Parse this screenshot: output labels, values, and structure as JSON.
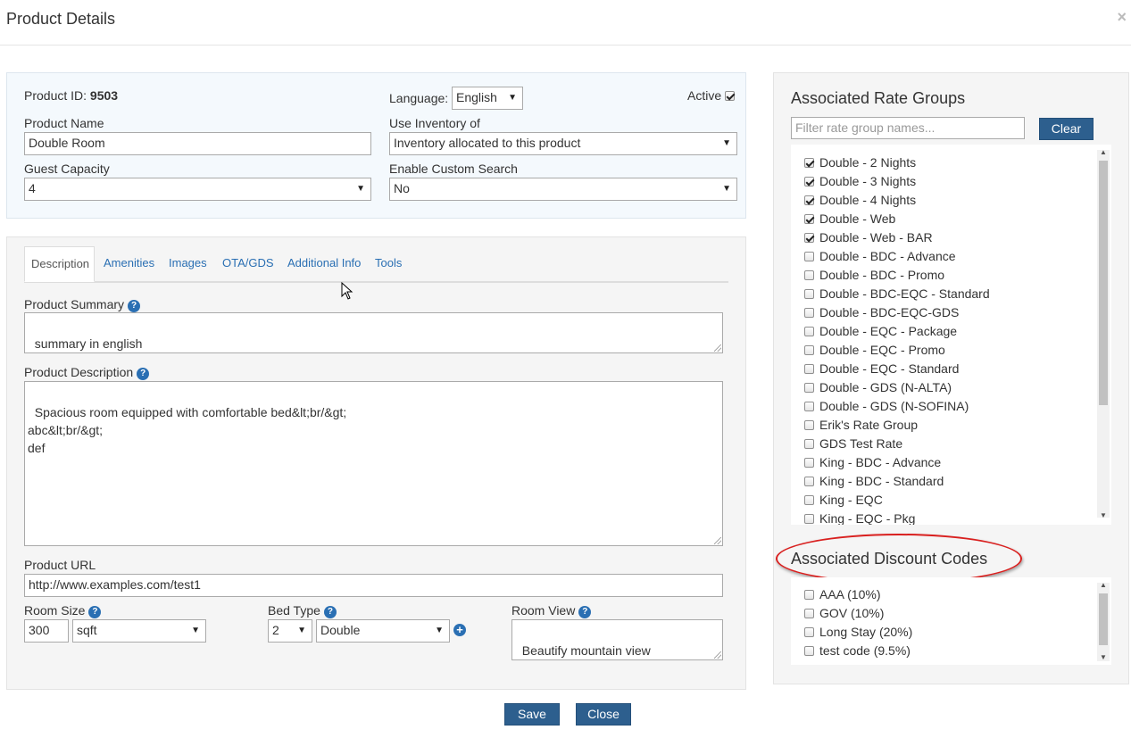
{
  "modal": {
    "title": "Product Details",
    "close_glyph": "×"
  },
  "top": {
    "product_id_label": "Product ID:",
    "product_id_value": "9503",
    "language_label": "Language:",
    "language_value": "English",
    "active_label": "Active",
    "active_checked": true,
    "product_name_label": "Product Name",
    "product_name_value": "Double Room",
    "use_inventory_label": "Use Inventory of",
    "use_inventory_value": "Inventory allocated to this product",
    "guest_capacity_label": "Guest Capacity",
    "guest_capacity_value": "4",
    "custom_search_label": "Enable Custom Search",
    "custom_search_value": "No"
  },
  "tabs": [
    {
      "label": "Description",
      "active": true
    },
    {
      "label": "Amenities",
      "active": false
    },
    {
      "label": "Images",
      "active": false
    },
    {
      "label": "OTA/GDS",
      "active": false
    },
    {
      "label": "Additional Info",
      "active": false
    },
    {
      "label": "Tools",
      "active": false
    }
  ],
  "description": {
    "summary_label": "Product Summary",
    "summary_value": "summary in english",
    "description_label": "Product Description",
    "description_value": "Spacious room equipped with comfortable bed&lt;br/&gt;\nabc&lt;br/&gt;\ndef",
    "url_label": "Product URL",
    "url_value": "http://www.examples.com/test1",
    "room_size_label": "Room Size",
    "room_size_value": "300",
    "room_size_unit": "sqft",
    "bed_type_label": "Bed Type",
    "bed_count": "2",
    "bed_type_value": "Double",
    "room_view_label": "Room View",
    "room_view_value": "Beautify mountain view"
  },
  "rate_groups": {
    "title": "Associated Rate Groups",
    "filter_placeholder": "Filter rate group names...",
    "clear_label": "Clear",
    "items": [
      {
        "label": "Double - 2 Nights",
        "checked": true
      },
      {
        "label": "Double - 3 Nights",
        "checked": true
      },
      {
        "label": "Double - 4 Nights",
        "checked": true
      },
      {
        "label": "Double - Web",
        "checked": true
      },
      {
        "label": "Double - Web - BAR",
        "checked": true
      },
      {
        "label": "Double - BDC - Advance",
        "checked": false
      },
      {
        "label": "Double - BDC - Promo",
        "checked": false
      },
      {
        "label": "Double - BDC-EQC - Standard",
        "checked": false
      },
      {
        "label": "Double - BDC-EQC-GDS",
        "checked": false
      },
      {
        "label": "Double - EQC - Package",
        "checked": false
      },
      {
        "label": "Double - EQC - Promo",
        "checked": false
      },
      {
        "label": "Double - EQC - Standard",
        "checked": false
      },
      {
        "label": "Double - GDS (N-ALTA)",
        "checked": false
      },
      {
        "label": "Double - GDS (N-SOFINA)",
        "checked": false
      },
      {
        "label": "Erik's Rate Group",
        "checked": false
      },
      {
        "label": "GDS Test Rate",
        "checked": false
      },
      {
        "label": "King - BDC - Advance",
        "checked": false
      },
      {
        "label": "King - BDC - Standard",
        "checked": false
      },
      {
        "label": "King - EQC",
        "checked": false
      },
      {
        "label": "King - EQC - Pkg",
        "checked": false
      }
    ]
  },
  "discount_codes": {
    "title": "Associated Discount Codes",
    "items": [
      {
        "label": "AAA (10%)",
        "checked": false
      },
      {
        "label": "GOV (10%)",
        "checked": false
      },
      {
        "label": "Long Stay (20%)",
        "checked": false
      },
      {
        "label": "test code (9.5%)",
        "checked": false
      }
    ]
  },
  "footer": {
    "save_label": "Save",
    "close_label": "Close"
  }
}
